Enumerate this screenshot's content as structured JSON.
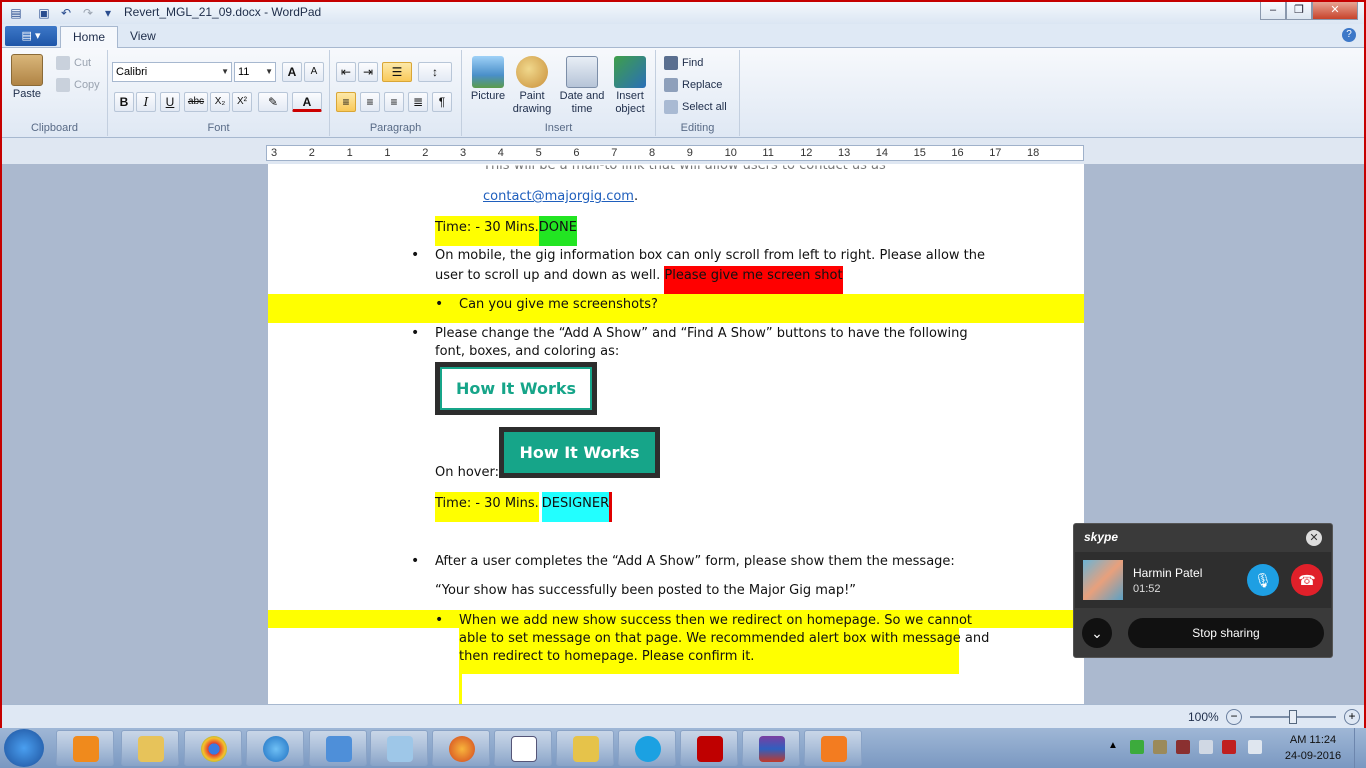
{
  "window": {
    "title": "Revert_MGL_21_09.docx - WordPad",
    "min_label": "–",
    "max_label": "❐",
    "close_label": "✕"
  },
  "ribbon": {
    "app_menu_label": "▤ ▾",
    "tabs": [
      "Home",
      "View"
    ],
    "help_label": "?",
    "clipboard": {
      "paste": "Paste",
      "cut": "Cut",
      "copy": "Copy",
      "label": "Clipboard"
    },
    "font": {
      "family": "Calibri",
      "size": "11",
      "label": "Font",
      "grow": "A",
      "shrink": "A",
      "bold": "B",
      "italic": "I",
      "underline": "U",
      "strike": "abc",
      "sub": "X₂",
      "sup": "X²",
      "highlight": "✎",
      "color": "A"
    },
    "paragraph": {
      "label": "Paragraph"
    },
    "insert": {
      "picture": "Picture",
      "paint": "Paint",
      "paint2": "drawing",
      "date": "Date and",
      "date2": "time",
      "object": "Insert",
      "object2": "object",
      "label": "Insert"
    },
    "editing": {
      "find": "Find",
      "replace": "Replace",
      "select_all": "Select all",
      "label": "Editing"
    }
  },
  "ruler": {
    "ticks": [
      "3",
      "2",
      "1",
      "1",
      "2",
      "3",
      "4",
      "5",
      "6",
      "7",
      "8",
      "9",
      "10",
      "11",
      "12",
      "13",
      "14",
      "15",
      "16",
      "17",
      "18"
    ]
  },
  "document": {
    "top_partial": "This will be a mail-to link that will allow users to contact us as",
    "email": "contact@majorgig.com",
    "email_tail": ".",
    "time1": "Time: - 30 Mins.",
    "done": "DONE",
    "mobile_line1": "On mobile, the gig information box can only scroll from left to right. Please allow the",
    "mobile_line2": "user to scroll up and down as well. ",
    "screenshot_req": "Please give me screen shot",
    "sub1": "Can you give me screenshots?",
    "change_line1": "Please change the “Add A Show” and “Find A Show” buttons to have the following",
    "change_line2": "font, boxes, and coloring as:",
    "hiw_btn": "How It Works",
    "hiw_btn_hover": "How It Works",
    "on_hover": "On hover:",
    "time2": "Time: - 30 Mins.",
    "designer": "DESIGNER",
    "after_line": "After a user completes the “Add A Show” form, please show them the message:",
    "message": "“Your show has successfully been posted to the Major Gig map!”",
    "sub2_line1": "When we add new show success then we redirect on homepage. So we cannot",
    "sub2_line2": "able to set message on that page. We recommended alert box with message and",
    "sub2_line3": "then redirect to homepage. Please confirm it."
  },
  "statusbar": {
    "zoom": "100%",
    "zoom_level_percent": 100
  },
  "skype": {
    "brand": "skype",
    "caller": "Harmin Patel",
    "duration": "01:52",
    "stop_sharing": "Stop sharing",
    "close": "✕"
  },
  "taskbar": {
    "time": "AM 11:24",
    "date": "24-09-2016"
  }
}
